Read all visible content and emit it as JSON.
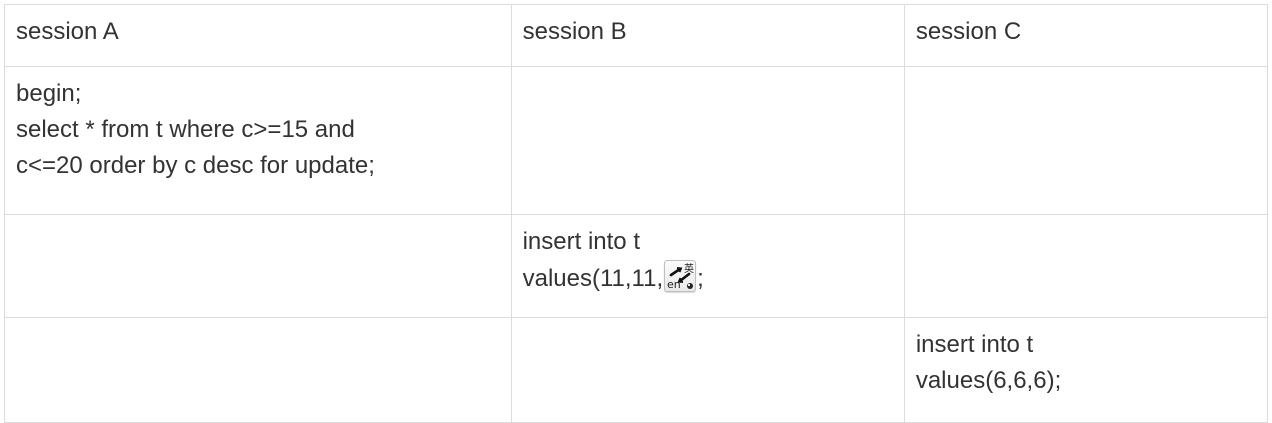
{
  "table": {
    "headers": [
      "session A",
      "session B",
      "session C"
    ],
    "rows": [
      {
        "a": "begin;\nselect * from t where c>=15 and\nc<=20 order by c desc  for update;",
        "b": "",
        "c": ""
      },
      {
        "a": "",
        "b_line1": "insert into t",
        "b_line2_prefix": "values(11,11,",
        "b_line2_suffix": ";",
        "c": ""
      },
      {
        "a": "",
        "b": "",
        "c": "insert into t\nvalues(6,6,6);"
      }
    ]
  },
  "ime_icon": {
    "name": "ime-toggle-icon",
    "label_top": "英",
    "label_bottom": "en"
  }
}
